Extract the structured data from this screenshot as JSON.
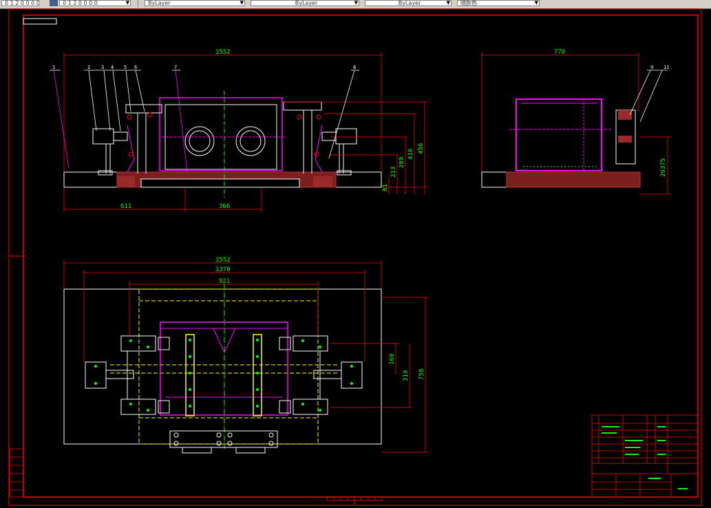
{
  "toolbar": {
    "combos": [
      {
        "value": "0 1 2 0 0 0 0"
      },
      {
        "value": "ByLayer"
      },
      {
        "value": "ByLayer"
      },
      {
        "value": "ByLayer"
      },
      {
        "value": "随颜色"
      }
    ]
  },
  "drawing": {
    "colors": {
      "frame": "#ff0000",
      "dim": "#ff0000",
      "dim_text": "#00ff00",
      "part": "#ffffff",
      "magenta": "#ff00ff",
      "hatch": "#c83232",
      "yellow": "#ffff00",
      "center": "#00ff00"
    },
    "front_view": {
      "dims": {
        "overall": "1552",
        "left": "611",
        "mid": "366",
        "h1": "416",
        "h2": "456",
        "h3": "289",
        "h4": "213",
        "h5": "81"
      },
      "balloons": [
        "1",
        "2",
        "3",
        "4",
        "5",
        "6",
        "7",
        "8"
      ]
    },
    "side_view": {
      "dims": {
        "width": "770",
        "height": "29375"
      },
      "balloons": [
        "9",
        "11"
      ]
    },
    "top_view": {
      "dims": {
        "overall": "1552",
        "inner": "1370",
        "core": "921",
        "v1": "160",
        "v2": "319",
        "v3": "758"
      }
    }
  }
}
